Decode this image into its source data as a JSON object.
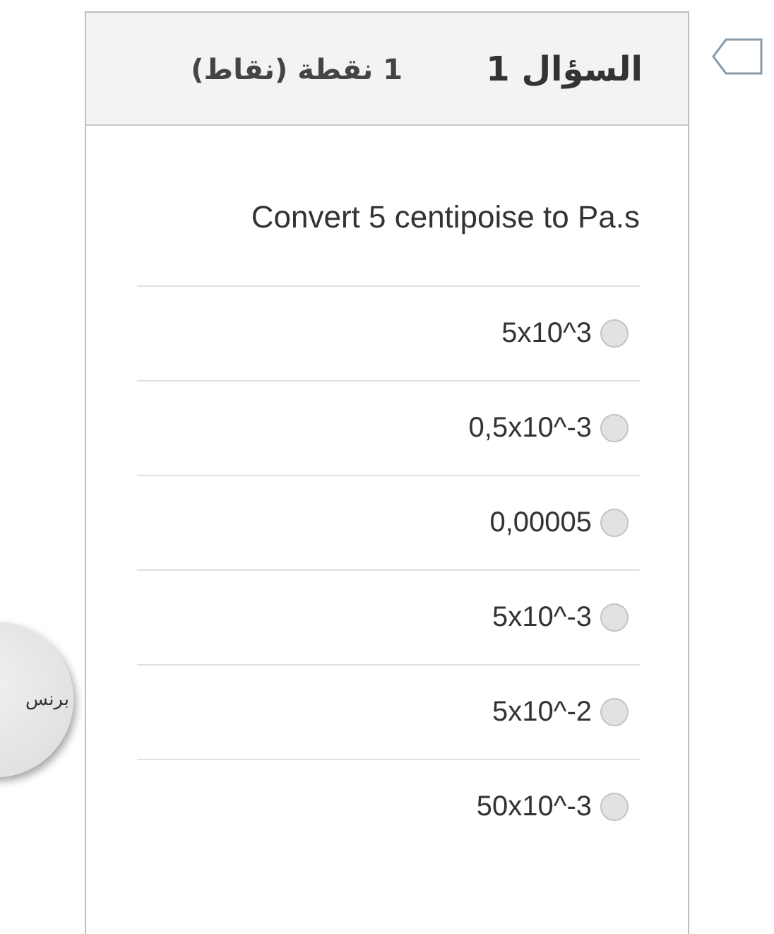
{
  "question": {
    "title": "السؤال 1",
    "points": "1 نقطة (نقاط)",
    "flagged": false,
    "text": "Convert 5 centipoise to Pa.s",
    "options": [
      {
        "label": "5x10^3",
        "selected": false
      },
      {
        "label": "0,5x10^-3",
        "selected": false
      },
      {
        "label": "0,00005",
        "selected": false
      },
      {
        "label": "5x10^-3",
        "selected": false
      },
      {
        "label": "5x10^-2",
        "selected": false
      },
      {
        "label": "50x10^-3",
        "selected": false
      }
    ]
  },
  "side_button": {
    "label": "برنس"
  }
}
